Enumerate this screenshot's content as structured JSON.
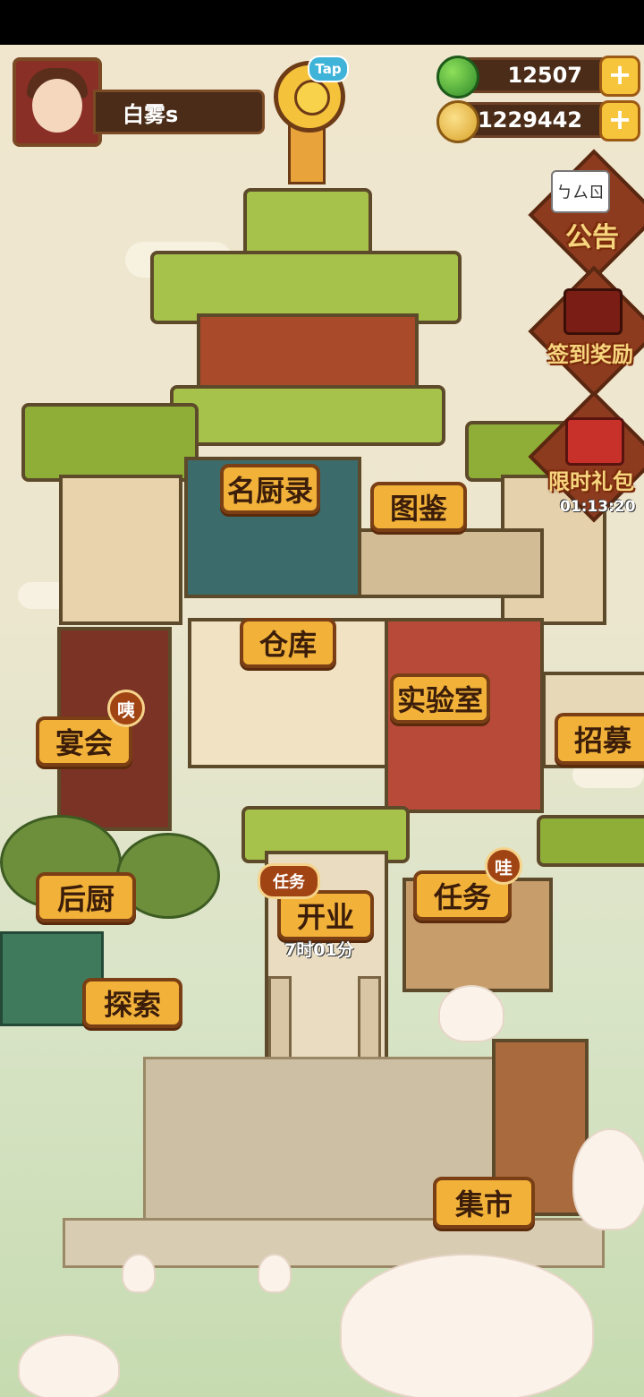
{
  "player": {
    "name": "白雾s"
  },
  "tap_button": {
    "label": "Tap"
  },
  "resources": {
    "jade": {
      "value": "12507",
      "icon": "jade-icon"
    },
    "coins": {
      "value": "21229442",
      "icon": "coin-icon"
    }
  },
  "side_menu": {
    "notice": {
      "label": "公告",
      "sign": "ㄅㄙㄖ"
    },
    "checkin": {
      "label": "签到奖励"
    },
    "gift": {
      "label": "限时礼包",
      "timer": "01:13:20"
    }
  },
  "buildings": {
    "chef_records": "名厨录",
    "encyclopedia": "图鉴",
    "warehouse": "仓库",
    "lab": "实验室",
    "banquet": "宴会",
    "recruit": "招募",
    "back_kitchen": "后厨",
    "explore": "探索",
    "open": "开业",
    "tasks": "任务",
    "market": "集市"
  },
  "badges": {
    "banquet": "咦",
    "open_task": "任务",
    "tasks": "哇"
  },
  "open_timer": "7时01分",
  "colors": {
    "label_bg": "#f2b23a",
    "label_border": "#7a3f14",
    "roof": "#a7c24a"
  }
}
